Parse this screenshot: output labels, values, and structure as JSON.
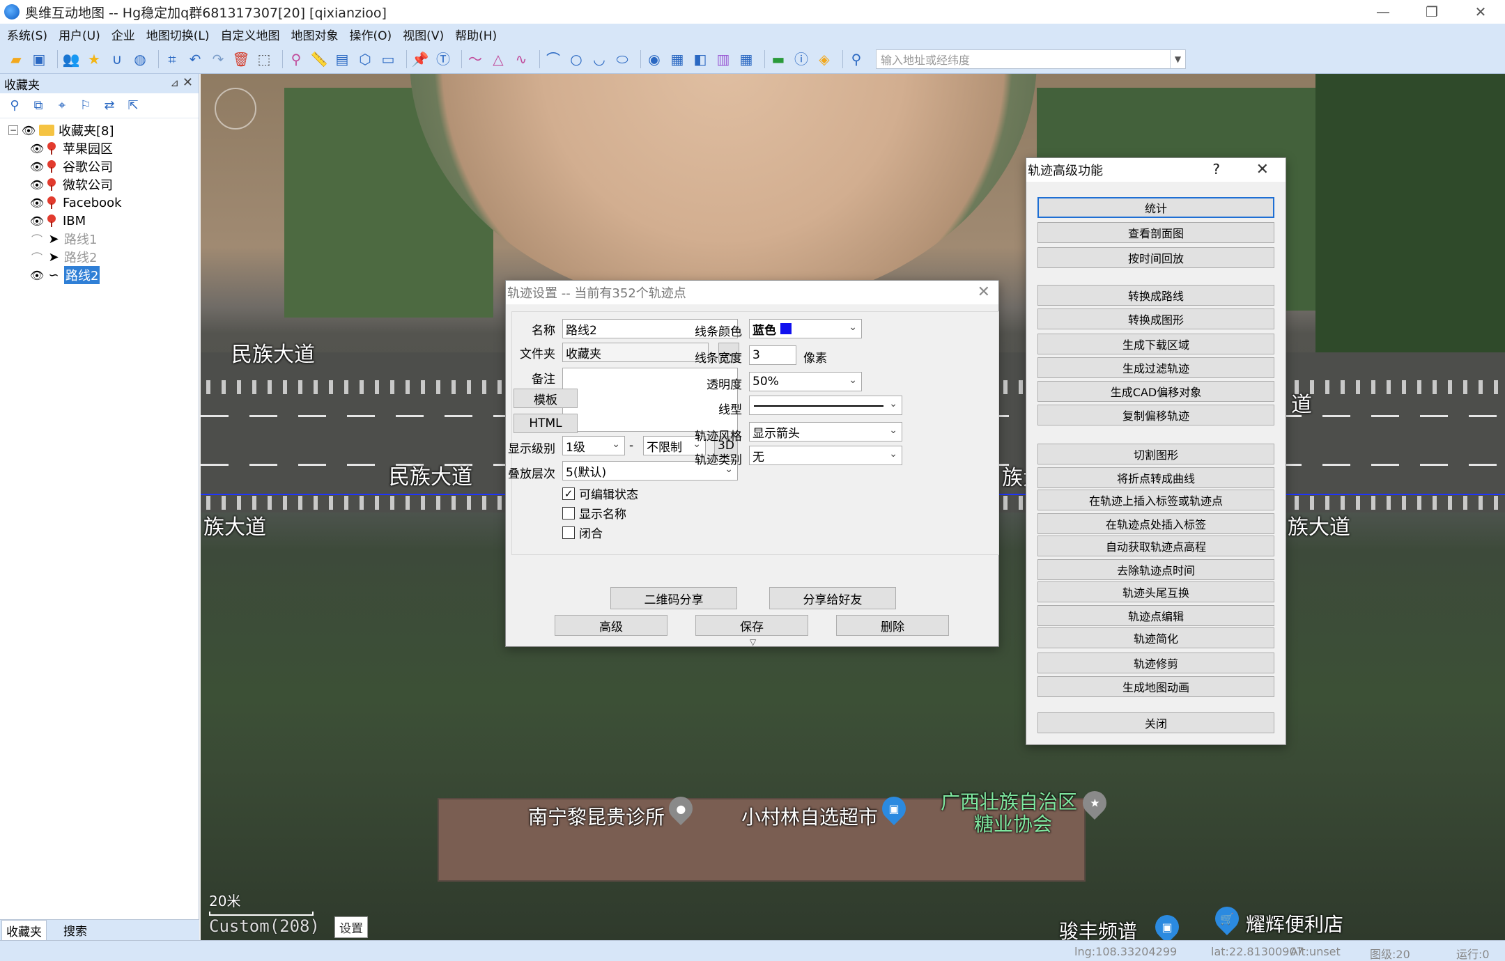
{
  "window": {
    "title": "奥维互动地图 -- Hg稳定加q群681317307[20] [qixianzioo]",
    "minimize": "—",
    "restore": "❐",
    "close": "✕"
  },
  "menu": [
    "系统(S)",
    "用户(U)",
    "企业",
    "地图切换(L)",
    "自定义地图",
    "地图对象",
    "操作(O)",
    "视图(V)",
    "帮助(H)"
  ],
  "toolbar": {
    "search_placeholder": "输入地址或经纬度"
  },
  "left_panel": {
    "title": "收藏夹",
    "root_label": "收藏夹[8]",
    "items": [
      {
        "label": "苹果园区",
        "type": "pin"
      },
      {
        "label": "谷歌公司",
        "type": "pin"
      },
      {
        "label": "微软公司",
        "type": "pin"
      },
      {
        "label": "Facebook",
        "type": "pin"
      },
      {
        "label": "IBM",
        "type": "pin"
      },
      {
        "label": "路线1",
        "type": "route"
      },
      {
        "label": "路线2",
        "type": "route"
      },
      {
        "label": "路线2",
        "type": "track"
      }
    ],
    "tabs": [
      "收藏夹",
      "搜索"
    ]
  },
  "map": {
    "road_labels": [
      "民族大道",
      "民族大道",
      "族大道",
      "族大",
      "道",
      "族大道"
    ],
    "pois": [
      {
        "label": "南宁黎昆贵诊所",
        "color": "#ffffff"
      },
      {
        "label": "小村林自选超市",
        "color": "#ffffff"
      },
      {
        "label": "广西壮族自治区",
        "color": "#7fe8a0"
      },
      {
        "label": "糖业协会",
        "color": "#7fe8a0"
      },
      {
        "label": "骏丰频谱",
        "color": "#ffffff"
      },
      {
        "label": "耀辉便利店",
        "color": "#ffffff"
      }
    ],
    "scale": "20米",
    "custom_label": "Custom(208)",
    "settings_label": "设置"
  },
  "track_dialog": {
    "title": "轨迹设置 -- 当前有352个轨迹点",
    "name_label": "名称",
    "name_value": "路线2",
    "folder_label": "文件夹",
    "folder_value": "收藏夹",
    "browse_label": "..",
    "note_label": "备注",
    "template_btn": "模板",
    "html_btn": "HTML",
    "display_level_label": "显示级别",
    "display_level_value": "1级",
    "dash": "-",
    "display_level_max": "不限制",
    "btn_3d": "3D",
    "stack_label": "叠放层次",
    "stack_value": "5(默认)",
    "editable_label": "可编辑状态",
    "editable_checked": true,
    "show_name_label": "显示名称",
    "show_name_checked": false,
    "closed_label": "闭合",
    "closed_checked": false,
    "line_color_label": "线条颜色",
    "line_color_value": "蓝色",
    "line_color_hex": "#1010ee",
    "line_width_label": "线条宽度",
    "line_width_value": "3",
    "line_width_unit": "像素",
    "opacity_label": "透明度",
    "opacity_value": "50%",
    "line_type_label": "线型",
    "style_label": "轨迹风格",
    "style_value": "显示箭头",
    "category_label": "轨迹类别",
    "category_value": "无",
    "qr_share_btn": "二维码分享",
    "share_friend_btn": "分享给好友",
    "advanced_btn": "高级",
    "save_btn": "保存",
    "delete_btn": "删除"
  },
  "advanced_panel": {
    "title": "轨迹高级功能",
    "help": "?",
    "close_x": "✕",
    "buttons_group1": [
      "统计",
      "查看剖面图",
      "按时间回放"
    ],
    "buttons_group2": [
      "转换成路线",
      "转换成图形",
      "生成下载区域",
      "生成过滤轨迹",
      "生成CAD偏移对象",
      "复制偏移轨迹"
    ],
    "buttons_group3": [
      "切割图形",
      "将折点转成曲线",
      "在轨迹上插入标签或轨迹点",
      "在轨迹点处插入标签",
      "自动获取轨迹点高程",
      "去除轨迹点时间",
      "轨迹头尾互换",
      "轨迹点编辑",
      "轨迹简化",
      "轨迹修剪",
      "生成地图动画"
    ],
    "close_btn": "关闭"
  },
  "status": {
    "lng": "lng:108.33204299",
    "lat": "lat:22.81300907",
    "alt": "Alt:unset",
    "level": "图级:20",
    "run": "运行:0"
  },
  "colors": {
    "chrome": "#d7e6f8",
    "route": "#1f34ff",
    "selection": "#2f7fd6"
  }
}
